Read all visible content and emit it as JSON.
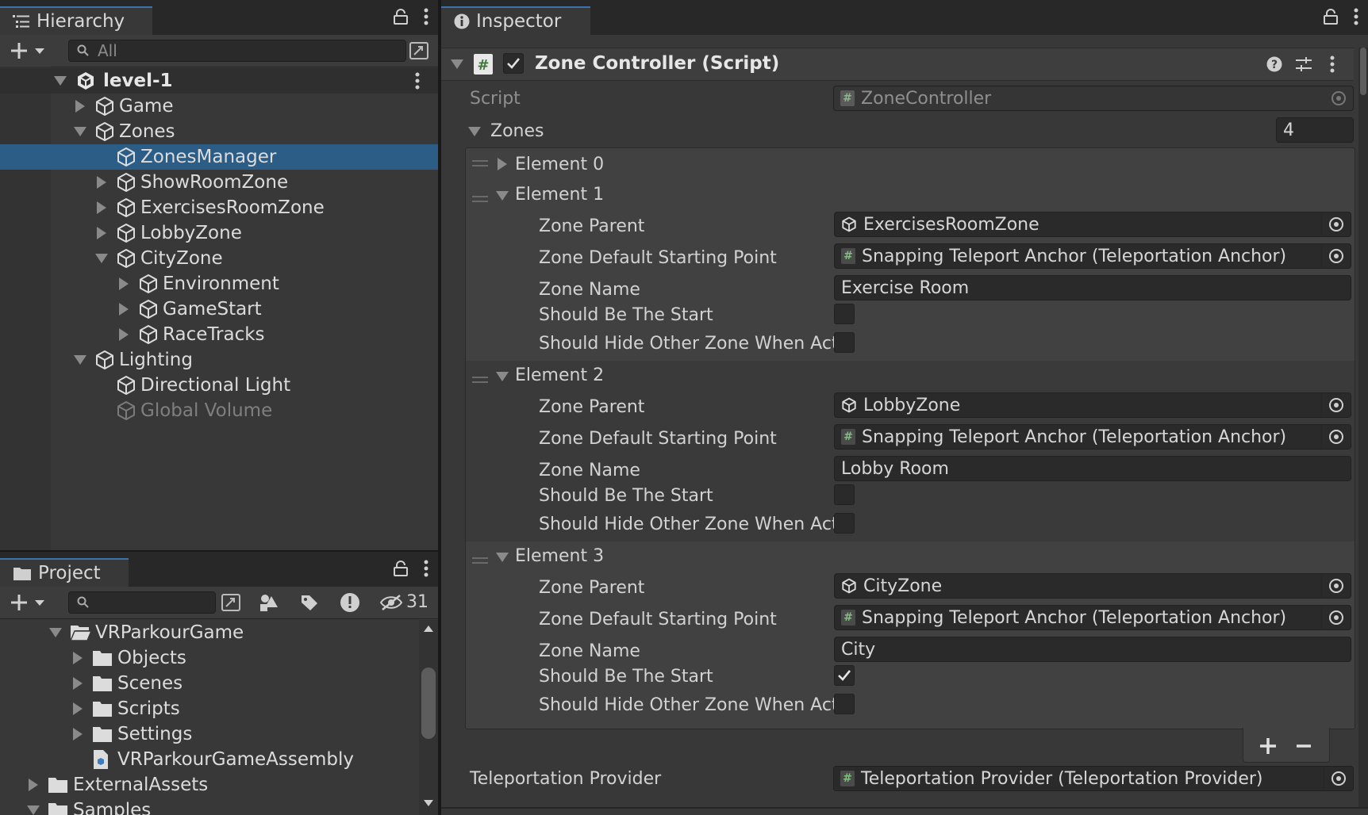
{
  "hierarchy": {
    "tab_label": "Hierarchy",
    "search_placeholder": "All",
    "scene": "level-1",
    "items": [
      {
        "label": "Game"
      },
      {
        "label": "Zones"
      },
      {
        "label": "ZonesManager"
      },
      {
        "label": "ShowRoomZone"
      },
      {
        "label": "ExercisesRoomZone"
      },
      {
        "label": "LobbyZone"
      },
      {
        "label": "CityZone"
      },
      {
        "label": "Environment"
      },
      {
        "label": "GameStart"
      },
      {
        "label": "RaceTracks"
      },
      {
        "label": "Lighting"
      },
      {
        "label": "Directional Light"
      },
      {
        "label": "Global Volume"
      }
    ]
  },
  "project": {
    "tab_label": "Project",
    "hidden_count": "31",
    "items": [
      {
        "label": "VRParkourGame"
      },
      {
        "label": "Objects"
      },
      {
        "label": "Scenes"
      },
      {
        "label": "Scripts"
      },
      {
        "label": "Settings"
      },
      {
        "label": "VRParkourGameAssembly"
      },
      {
        "label": "ExternalAssets"
      },
      {
        "label": "Samples"
      }
    ]
  },
  "inspector": {
    "tab_label": "Inspector",
    "component_title": "Zone Controller (Script)",
    "script_label": "Script",
    "script_value": "ZoneController",
    "zones_label": "Zones",
    "zones_count": "4",
    "element0": "Element 0",
    "labels": {
      "zone_parent": "Zone Parent",
      "starting_point": "Zone Default Starting Point",
      "zone_name": "Zone Name",
      "should_be_start": "Should Be The Start",
      "should_hide": "Should Hide Other Zone When Act"
    },
    "elements": [
      {
        "title": "Element 1",
        "zone_parent": "ExercisesRoomZone",
        "starting_point": "Snapping Teleport Anchor (Teleportation Anchor)",
        "zone_name": "Exercise Room",
        "should_be_start": false,
        "should_hide": false
      },
      {
        "title": "Element 2",
        "zone_parent": "LobbyZone",
        "starting_point": "Snapping Teleport Anchor (Teleportation Anchor)",
        "zone_name": "Lobby Room",
        "should_be_start": false,
        "should_hide": false
      },
      {
        "title": "Element 3",
        "zone_parent": "CityZone",
        "starting_point": "Snapping Teleport Anchor (Teleportation Anchor)",
        "zone_name": "City",
        "should_be_start": true,
        "should_hide": false
      }
    ],
    "teleport_label": "Teleportation Provider",
    "teleport_value": "Teleportation Provider (Teleportation Provider)"
  }
}
